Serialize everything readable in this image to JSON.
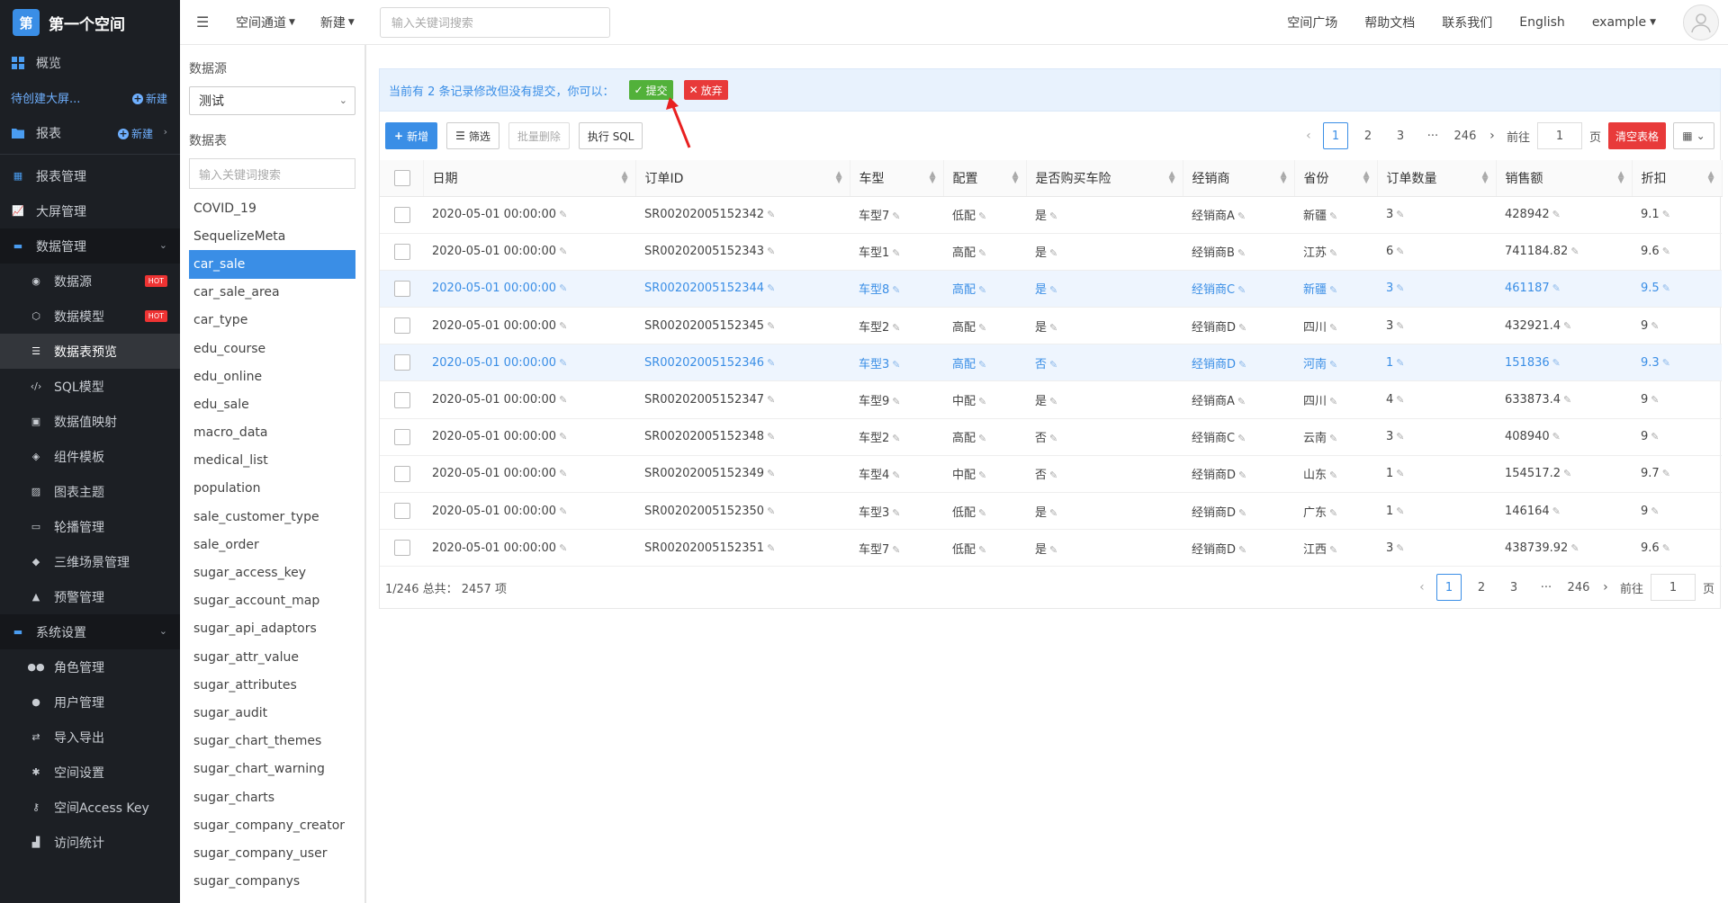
{
  "brand": {
    "logo": "第",
    "title": "第一个空间"
  },
  "sidebar": {
    "overview": "概览",
    "pending": "待创建大屏...",
    "new": "新建",
    "report": "报表",
    "items": [
      {
        "label": "报表管理",
        "icon": "table-icon"
      },
      {
        "label": "大屏管理",
        "icon": "chart-icon"
      },
      {
        "label": "数据管理",
        "icon": "folder-icon"
      },
      {
        "label": "数据源",
        "icon": "database-icon",
        "badge": "HOT"
      },
      {
        "label": "数据模型",
        "icon": "model-icon",
        "badge": "HOT"
      },
      {
        "label": "数据表预览",
        "icon": "list-icon"
      },
      {
        "label": "SQL模型",
        "icon": "code-icon"
      },
      {
        "label": "数据值映射",
        "icon": "map-icon"
      },
      {
        "label": "组件模板",
        "icon": "component-icon"
      },
      {
        "label": "图表主题",
        "icon": "theme-icon"
      },
      {
        "label": "轮播管理",
        "icon": "monitor-icon"
      },
      {
        "label": "三维场景管理",
        "icon": "cube-icon"
      },
      {
        "label": "预警管理",
        "icon": "bell-icon"
      },
      {
        "label": "系统设置",
        "icon": "folder-icon"
      },
      {
        "label": "角色管理",
        "icon": "users-icon"
      },
      {
        "label": "用户管理",
        "icon": "user-icon"
      },
      {
        "label": "导入导出",
        "icon": "swap-icon"
      },
      {
        "label": "空间设置",
        "icon": "gear-icon"
      },
      {
        "label": "空间Access Key",
        "icon": "key-icon"
      },
      {
        "label": "访问统计",
        "icon": "stats-icon"
      }
    ]
  },
  "header": {
    "menu1": "空间通道",
    "menu2": "新建",
    "search_placeholder": "输入关键词搜索",
    "links": [
      "空间广场",
      "帮助文档",
      "联系我们",
      "English"
    ],
    "user": "example"
  },
  "panel": {
    "source_label": "数据源",
    "source_value": "测试",
    "table_label": "数据表",
    "search_placeholder": "输入关键词搜索",
    "tables": [
      "COVID_19",
      "SequelizeMeta",
      "car_sale",
      "car_sale_area",
      "car_type",
      "edu_course",
      "edu_online",
      "edu_sale",
      "macro_data",
      "medical_list",
      "population",
      "sale_customer_type",
      "sale_order",
      "sugar_access_key",
      "sugar_account_map",
      "sugar_api_adaptors",
      "sugar_attr_value",
      "sugar_attributes",
      "sugar_audit",
      "sugar_chart_themes",
      "sugar_chart_warning",
      "sugar_charts",
      "sugar_company_creator",
      "sugar_company_user",
      "sugar_companys"
    ],
    "selected": "car_sale"
  },
  "notice": {
    "text": "当前有 2 条记录修改但没有提交，你可以：",
    "submit": "提交",
    "discard": "放弃"
  },
  "toolbar": {
    "add": "新增",
    "filter": "筛选",
    "batch_delete": "批量删除",
    "exec_sql": "执行 SQL",
    "clear": "清空表格"
  },
  "pager": {
    "pages": [
      "1",
      "2",
      "3",
      "···",
      "246"
    ],
    "goto": "前往",
    "page_input": "1",
    "page_unit": "页"
  },
  "table": {
    "columns": [
      "日期",
      "订单ID",
      "车型",
      "配置",
      "是否购买车险",
      "经销商",
      "省份",
      "订单数量",
      "销售额",
      "折扣"
    ],
    "rows": [
      [
        "2020-05-01 00:00:00",
        "SR00202005152342",
        "车型7",
        "低配",
        "是",
        "经销商A",
        "新疆",
        "3",
        "428942",
        "9.1"
      ],
      [
        "2020-05-01 00:00:00",
        "SR00202005152343",
        "车型1",
        "高配",
        "是",
        "经销商B",
        "江苏",
        "6",
        "741184.82",
        "9.6"
      ],
      [
        "2020-05-01 00:00:00",
        "SR00202005152344",
        "车型8",
        "高配",
        "是",
        "经销商C",
        "新疆",
        "3",
        "461187",
        "9.5"
      ],
      [
        "2020-05-01 00:00:00",
        "SR00202005152345",
        "车型2",
        "高配",
        "是",
        "经销商D",
        "四川",
        "3",
        "432921.4",
        "9"
      ],
      [
        "2020-05-01 00:00:00",
        "SR00202005152346",
        "车型3",
        "高配",
        "否",
        "经销商D",
        "河南",
        "1",
        "151836",
        "9.3"
      ],
      [
        "2020-05-01 00:00:00",
        "SR00202005152347",
        "车型9",
        "中配",
        "是",
        "经销商A",
        "四川",
        "4",
        "633873.4",
        "9"
      ],
      [
        "2020-05-01 00:00:00",
        "SR00202005152348",
        "车型2",
        "高配",
        "否",
        "经销商C",
        "云南",
        "3",
        "408940",
        "9"
      ],
      [
        "2020-05-01 00:00:00",
        "SR00202005152349",
        "车型4",
        "中配",
        "否",
        "经销商D",
        "山东",
        "1",
        "154517.2",
        "9.7"
      ],
      [
        "2020-05-01 00:00:00",
        "SR00202005152350",
        "车型3",
        "低配",
        "是",
        "经销商D",
        "广东",
        "1",
        "146164",
        "9"
      ],
      [
        "2020-05-01 00:00:00",
        "SR00202005152351",
        "车型7",
        "低配",
        "是",
        "经销商D",
        "江西",
        "3",
        "438739.92",
        "9.6"
      ]
    ],
    "highlighted_rows": [
      2,
      4
    ]
  },
  "footer": {
    "summary": "1/246 总共： 2457 项"
  },
  "colors": {
    "accent": "#3a8ee6",
    "sidebar_bg": "#1c1f24",
    "submit": "#52b13a",
    "danger": "#e83a3a"
  }
}
